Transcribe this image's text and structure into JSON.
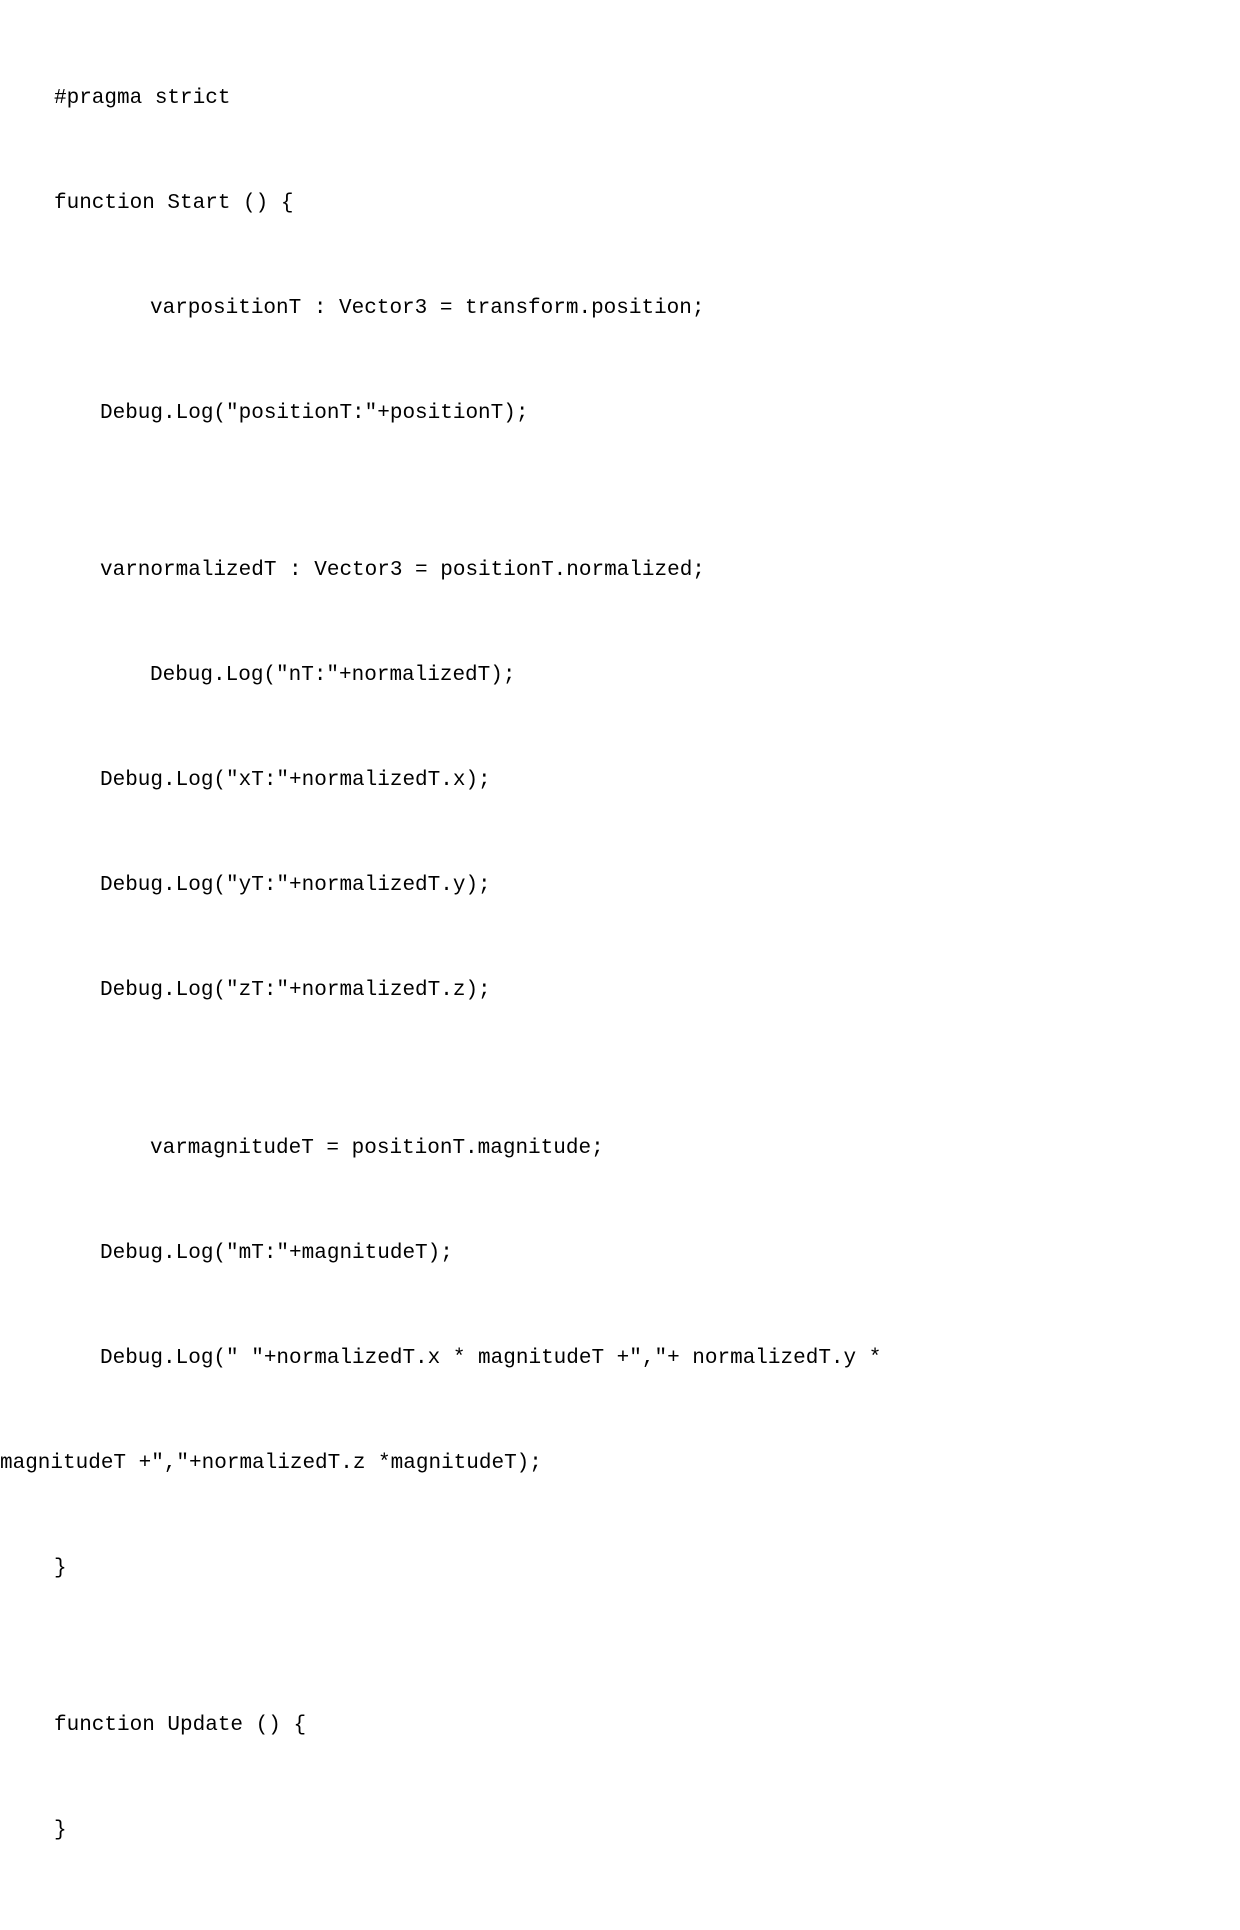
{
  "code": {
    "line1": "#pragma strict",
    "line2": "function Start () {",
    "line3": "varpositionT : Vector3 = transform.position;",
    "line4": "Debug.Log(\"positionT:\"+positionT);",
    "line5": "",
    "line6": "varnormalizedT : Vector3 = positionT.normalized;",
    "line7": "Debug.Log(\"nT:\"+normalizedT);",
    "line8": "Debug.Log(\"xT:\"+normalizedT.x);",
    "line9": "Debug.Log(\"yT:\"+normalizedT.y);",
    "line10": "Debug.Log(\"zT:\"+normalizedT.z);",
    "line11": "",
    "line12": "varmagnitudeT = positionT.magnitude;",
    "line13": "Debug.Log(\"mT:\"+magnitudeT);",
    "line14": "Debug.Log(\" \"+normalizedT.x * magnitudeT +\",\"+ normalizedT.y *",
    "line14b": "magnitudeT +\",\"+normalizedT.z *magnitudeT);",
    "line15": "}",
    "line16": "",
    "line17": "function Update () {",
    "line18": "}"
  }
}
